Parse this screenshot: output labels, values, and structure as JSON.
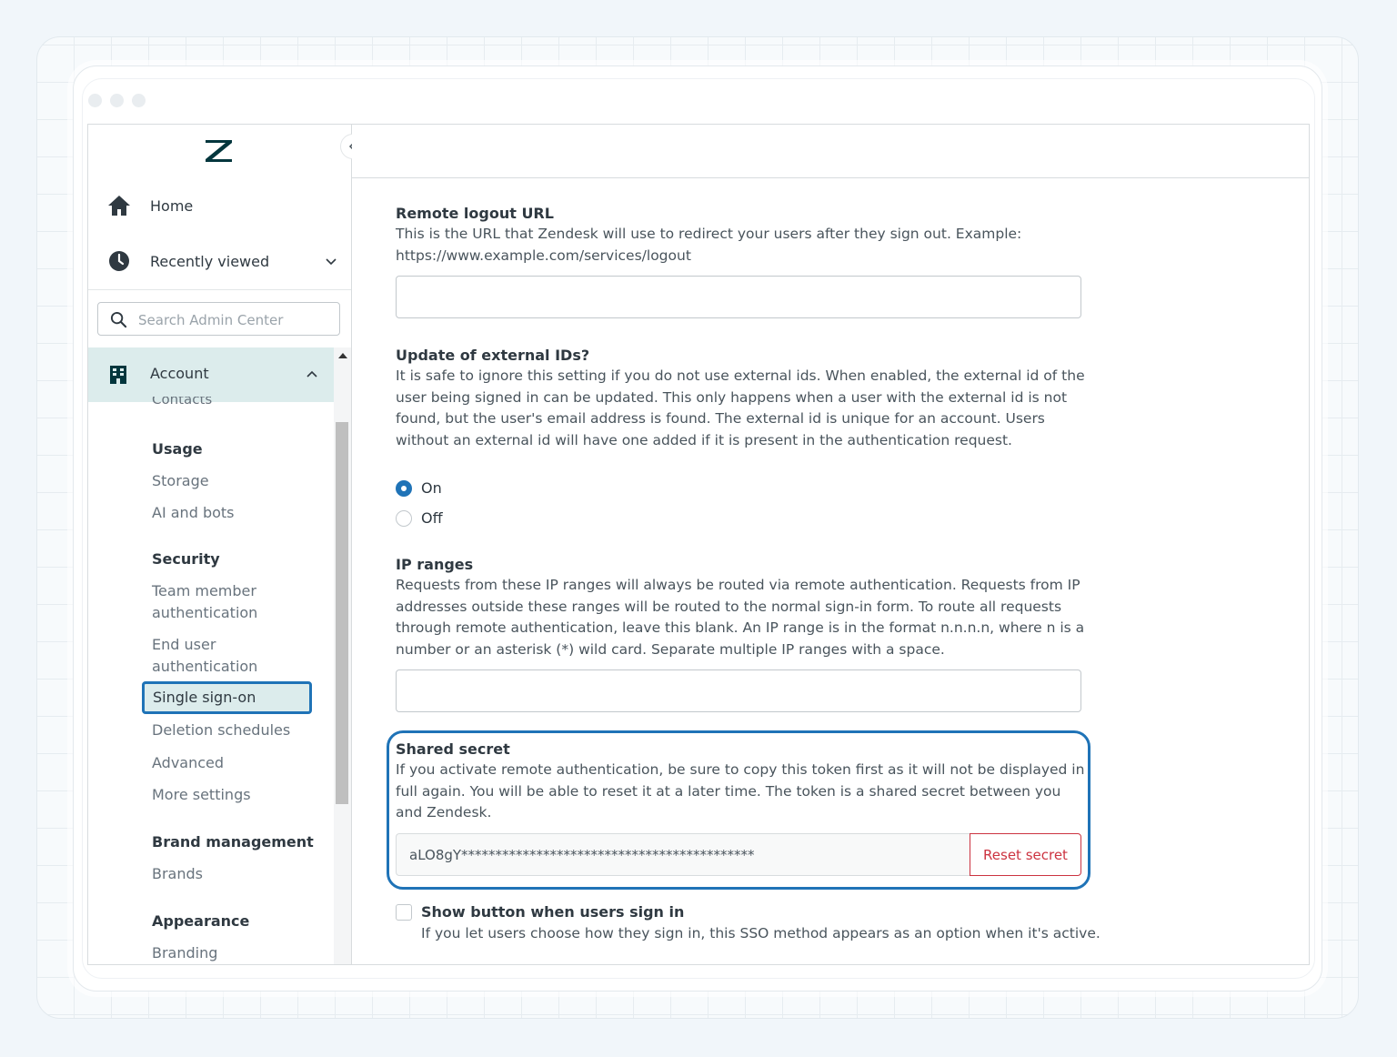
{
  "sidebar": {
    "home_label": "Home",
    "recent_label": "Recently viewed",
    "search_placeholder": "Search Admin Center",
    "account_label": "Account",
    "clipped_item": "Contacts",
    "usage": {
      "heading": "Usage",
      "items": [
        "Storage",
        "AI and bots"
      ]
    },
    "security": {
      "heading": "Security",
      "items": [
        "Team member authentication",
        "End user authentication",
        "Single sign-on",
        "Deletion schedules",
        "Advanced",
        "More settings"
      ]
    },
    "brand_management": {
      "heading": "Brand management",
      "items": [
        "Brands"
      ]
    },
    "appearance": {
      "heading": "Appearance",
      "items": [
        "Branding"
      ]
    }
  },
  "main": {
    "remote_logout": {
      "label": "Remote logout URL",
      "hint": "This is the URL that Zendesk will use to redirect your users after they sign out. Example: https://www.example.com/services/logout",
      "value": ""
    },
    "external_ids": {
      "label": "Update of external IDs?",
      "hint": "It is safe to ignore this setting if you do not use external ids. When enabled, the external id of the user being signed in can be updated. This only happens when a user with the external id is not found, but the user's email address is found. The external id is unique for an account. Users without an external id will have one added if it is present in the authentication request.",
      "options": [
        "On",
        "Off"
      ],
      "selected": "On"
    },
    "ip_ranges": {
      "label": "IP ranges",
      "hint": "Requests from these IP ranges will always be routed via remote authentication. Requests from IP addresses outside these ranges will be routed to the normal sign-in form. To route all requests through remote authentication, leave this blank. An IP range is in the format n.n.n.n, where n is a number or an asterisk (*) wild card. Separate multiple IP ranges with a space.",
      "value": ""
    },
    "shared_secret": {
      "label": "Shared secret",
      "hint": "If you activate remote authentication, be sure to copy this token first as it will not be displayed in full again. You will be able to reset it at a later time. The token is a shared secret between you and Zendesk.",
      "value": "aLO8gY*******************************************",
      "reset_label": "Reset secret"
    },
    "show_button": {
      "label": "Show button when users sign in",
      "hint": "If you let users choose how they sign in, this SSO method appears as an option when it's active.",
      "checked": false
    }
  },
  "colors": {
    "accent": "#1f73b7",
    "selected_bg": "#dcecec",
    "danger": "#cc3340",
    "logo": "#03363d"
  },
  "icons": [
    "zendesk-logo-icon",
    "home-icon",
    "clock-icon",
    "chevron-down-icon",
    "search-icon",
    "building-icon",
    "chevron-up-icon",
    "chevron-left-icon"
  ]
}
